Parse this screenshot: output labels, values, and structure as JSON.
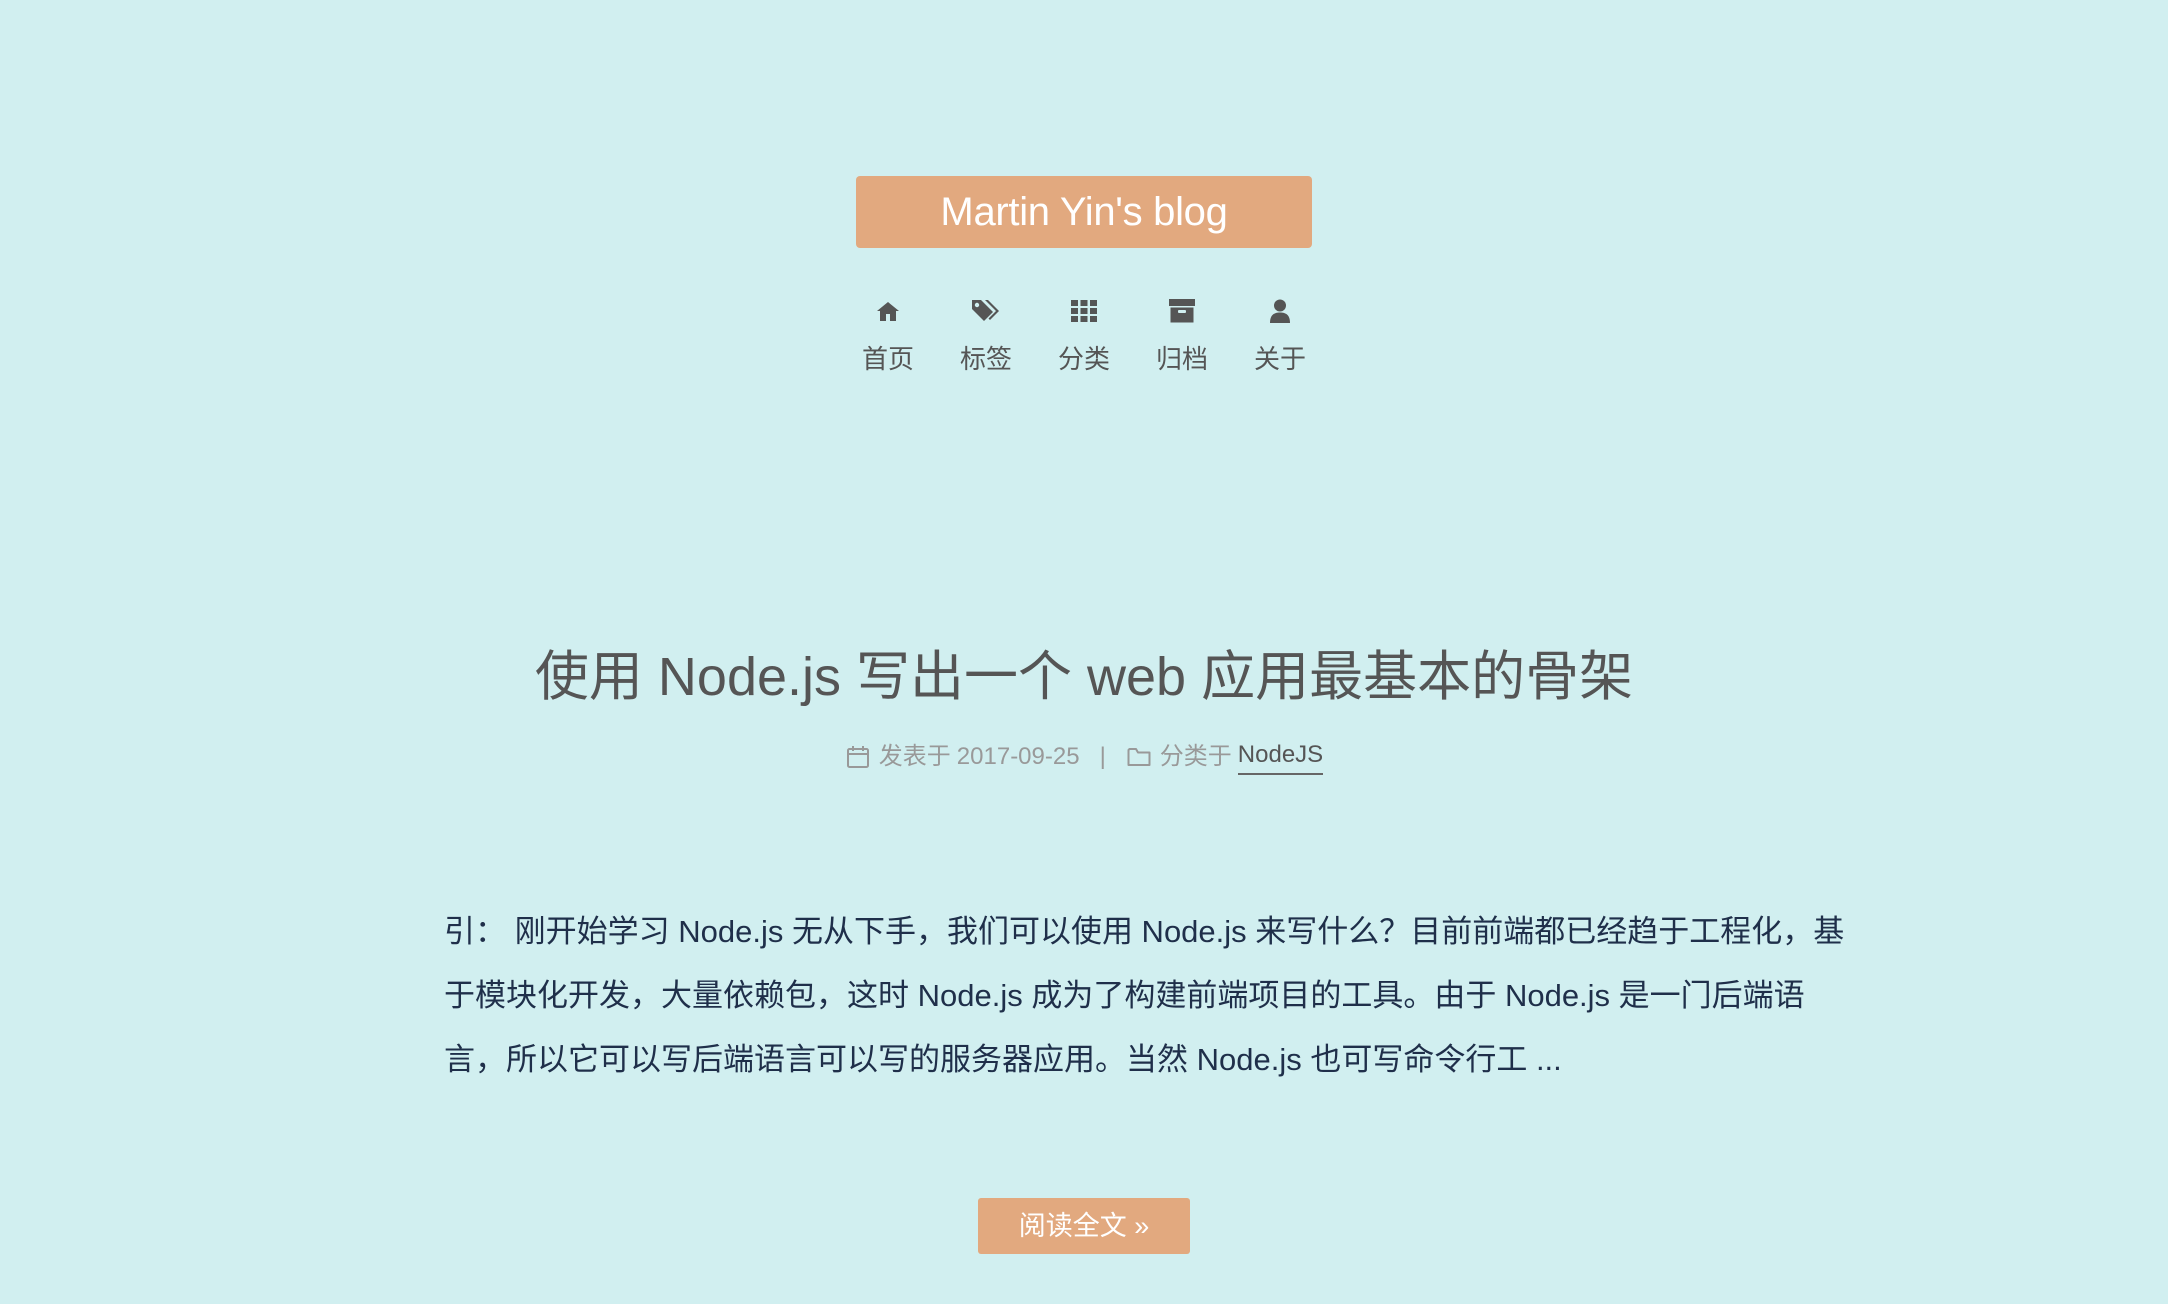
{
  "site": {
    "title": "Martin Yin's blog"
  },
  "menu": {
    "items": [
      {
        "label": "首页",
        "icon": "home-icon"
      },
      {
        "label": "标签",
        "icon": "tags-icon"
      },
      {
        "label": "分类",
        "icon": "grid-icon"
      },
      {
        "label": "归档",
        "icon": "archive-icon"
      },
      {
        "label": "关于",
        "icon": "user-icon"
      }
    ]
  },
  "post": {
    "title": "使用 Node.js 写出一个 web 应用最基本的骨架",
    "date_prefix": "发表于",
    "date": "2017-09-25",
    "separator": "|",
    "category_prefix": "分类于",
    "category": "NodeJS",
    "excerpt": "引： 刚开始学习 Node.js 无从下手，我们可以使用 Node.js 来写什么？目前前端都已经趋于工程化，基于模块化开发，大量依赖包，这时 Node.js 成为了构建前端项目的工具。由于 Node.js 是一门后端语言，所以它可以写后端语言可以写的服务器应用。当然 Node.js 也可写命令行工 ...",
    "read_more": "阅读全文 »"
  },
  "colors": {
    "background": "#d1eff0",
    "accent": "#e2a97f",
    "text": "#555555",
    "body_text": "#1f2f4a",
    "meta_text": "#999999"
  }
}
